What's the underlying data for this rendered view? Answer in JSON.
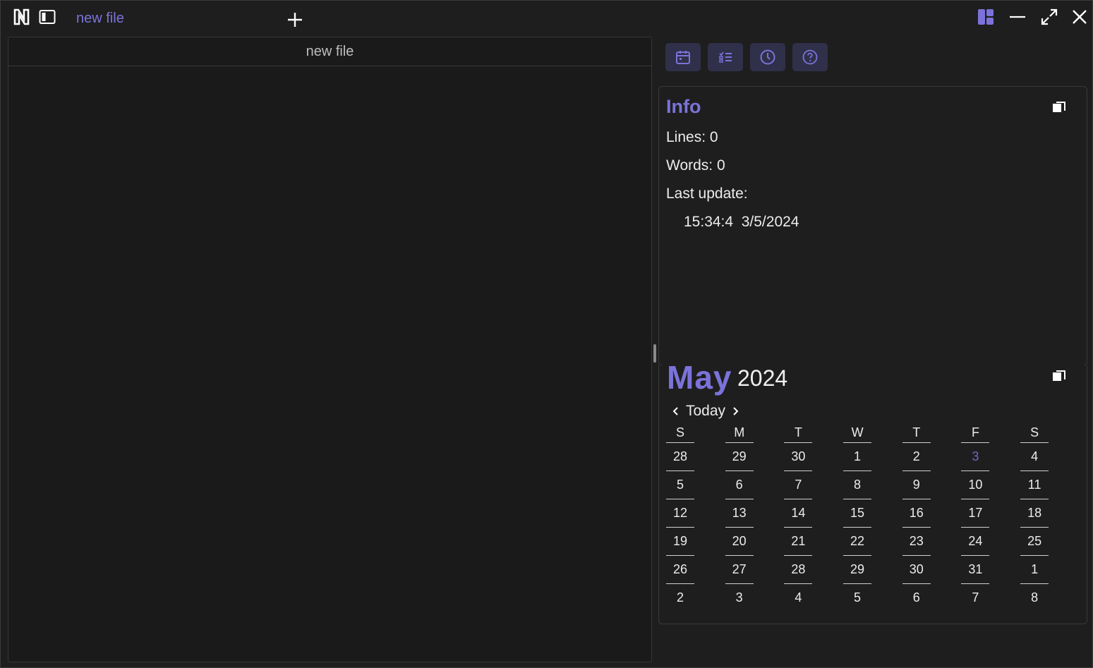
{
  "titlebar": {
    "tab_name": "new file",
    "add_tab": "+"
  },
  "editor": {
    "header_title": "new file",
    "content": ""
  },
  "toolbar": {
    "buttons": [
      "calendar-icon",
      "checklist-icon",
      "clock-icon",
      "help-icon"
    ]
  },
  "info": {
    "title": "Info",
    "lines_label": "Lines: 0",
    "words_label": "Words: 0",
    "last_update_label": "Last update:",
    "last_update_value": "15:34:4  3/5/2024"
  },
  "calendar": {
    "month": "May",
    "year": "2024",
    "today_label": "Today",
    "weekdays": [
      "S",
      "M",
      "T",
      "W",
      "T",
      "F",
      "S"
    ],
    "weeks": [
      [
        "28",
        "29",
        "30",
        "1",
        "2",
        "3",
        "4"
      ],
      [
        "5",
        "6",
        "7",
        "8",
        "9",
        "10",
        "11"
      ],
      [
        "12",
        "13",
        "14",
        "15",
        "16",
        "17",
        "18"
      ],
      [
        "19",
        "20",
        "21",
        "22",
        "23",
        "24",
        "25"
      ],
      [
        "26",
        "27",
        "28",
        "29",
        "30",
        "31",
        "1"
      ],
      [
        "2",
        "3",
        "4",
        "5",
        "6",
        "7",
        "8"
      ]
    ],
    "current_day": "3"
  },
  "colors": {
    "accent": "#7b73d9",
    "background": "#1e1e1e",
    "button_bg": "#30304a"
  }
}
